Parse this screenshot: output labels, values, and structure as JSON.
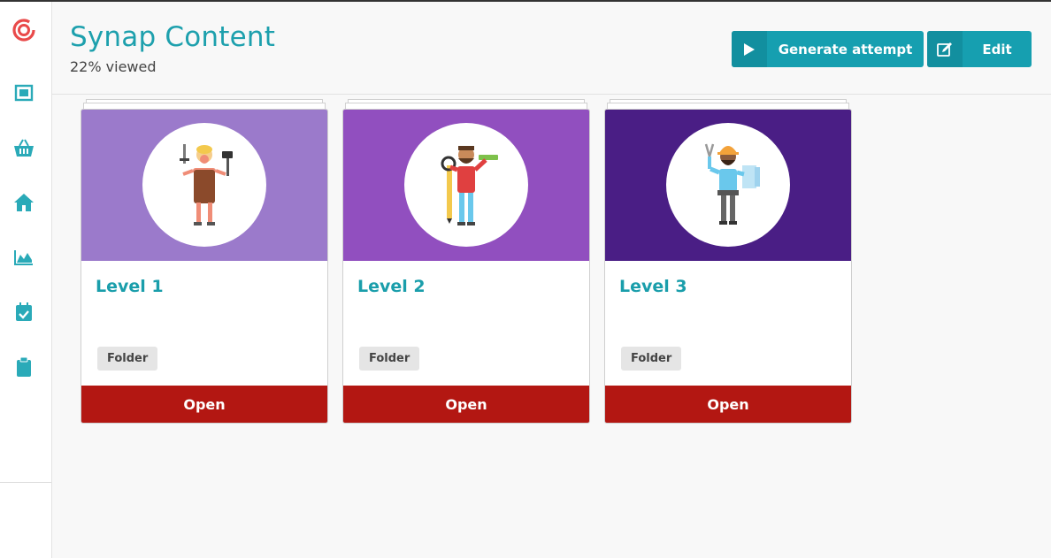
{
  "header": {
    "title": "Synap Content",
    "subtitle": "22% viewed",
    "generate_label": "Generate attempt",
    "edit_label": "Edit"
  },
  "sidebar": {
    "items": [
      {
        "icon": "dashboard-icon"
      },
      {
        "icon": "basket-icon"
      },
      {
        "icon": "home-icon"
      },
      {
        "icon": "area-chart-icon"
      },
      {
        "icon": "calendar-check-icon"
      },
      {
        "icon": "clipboard-icon"
      }
    ]
  },
  "cards": [
    {
      "title": "Level 1",
      "tag": "Folder",
      "action": "Open",
      "color": "#9b7acb",
      "icon": "blacksmith-illustration-icon"
    },
    {
      "title": "Level 2",
      "tag": "Folder",
      "action": "Open",
      "color": "#914fbf",
      "icon": "carpenter-illustration-icon"
    },
    {
      "title": "Level 3",
      "tag": "Folder",
      "action": "Open",
      "color": "#4a1e85",
      "icon": "engineer-illustration-icon"
    }
  ],
  "colors": {
    "accent": "#169fb0",
    "title": "#1da0ad",
    "open_button": "#b31712",
    "logo": "#e94a4a"
  }
}
